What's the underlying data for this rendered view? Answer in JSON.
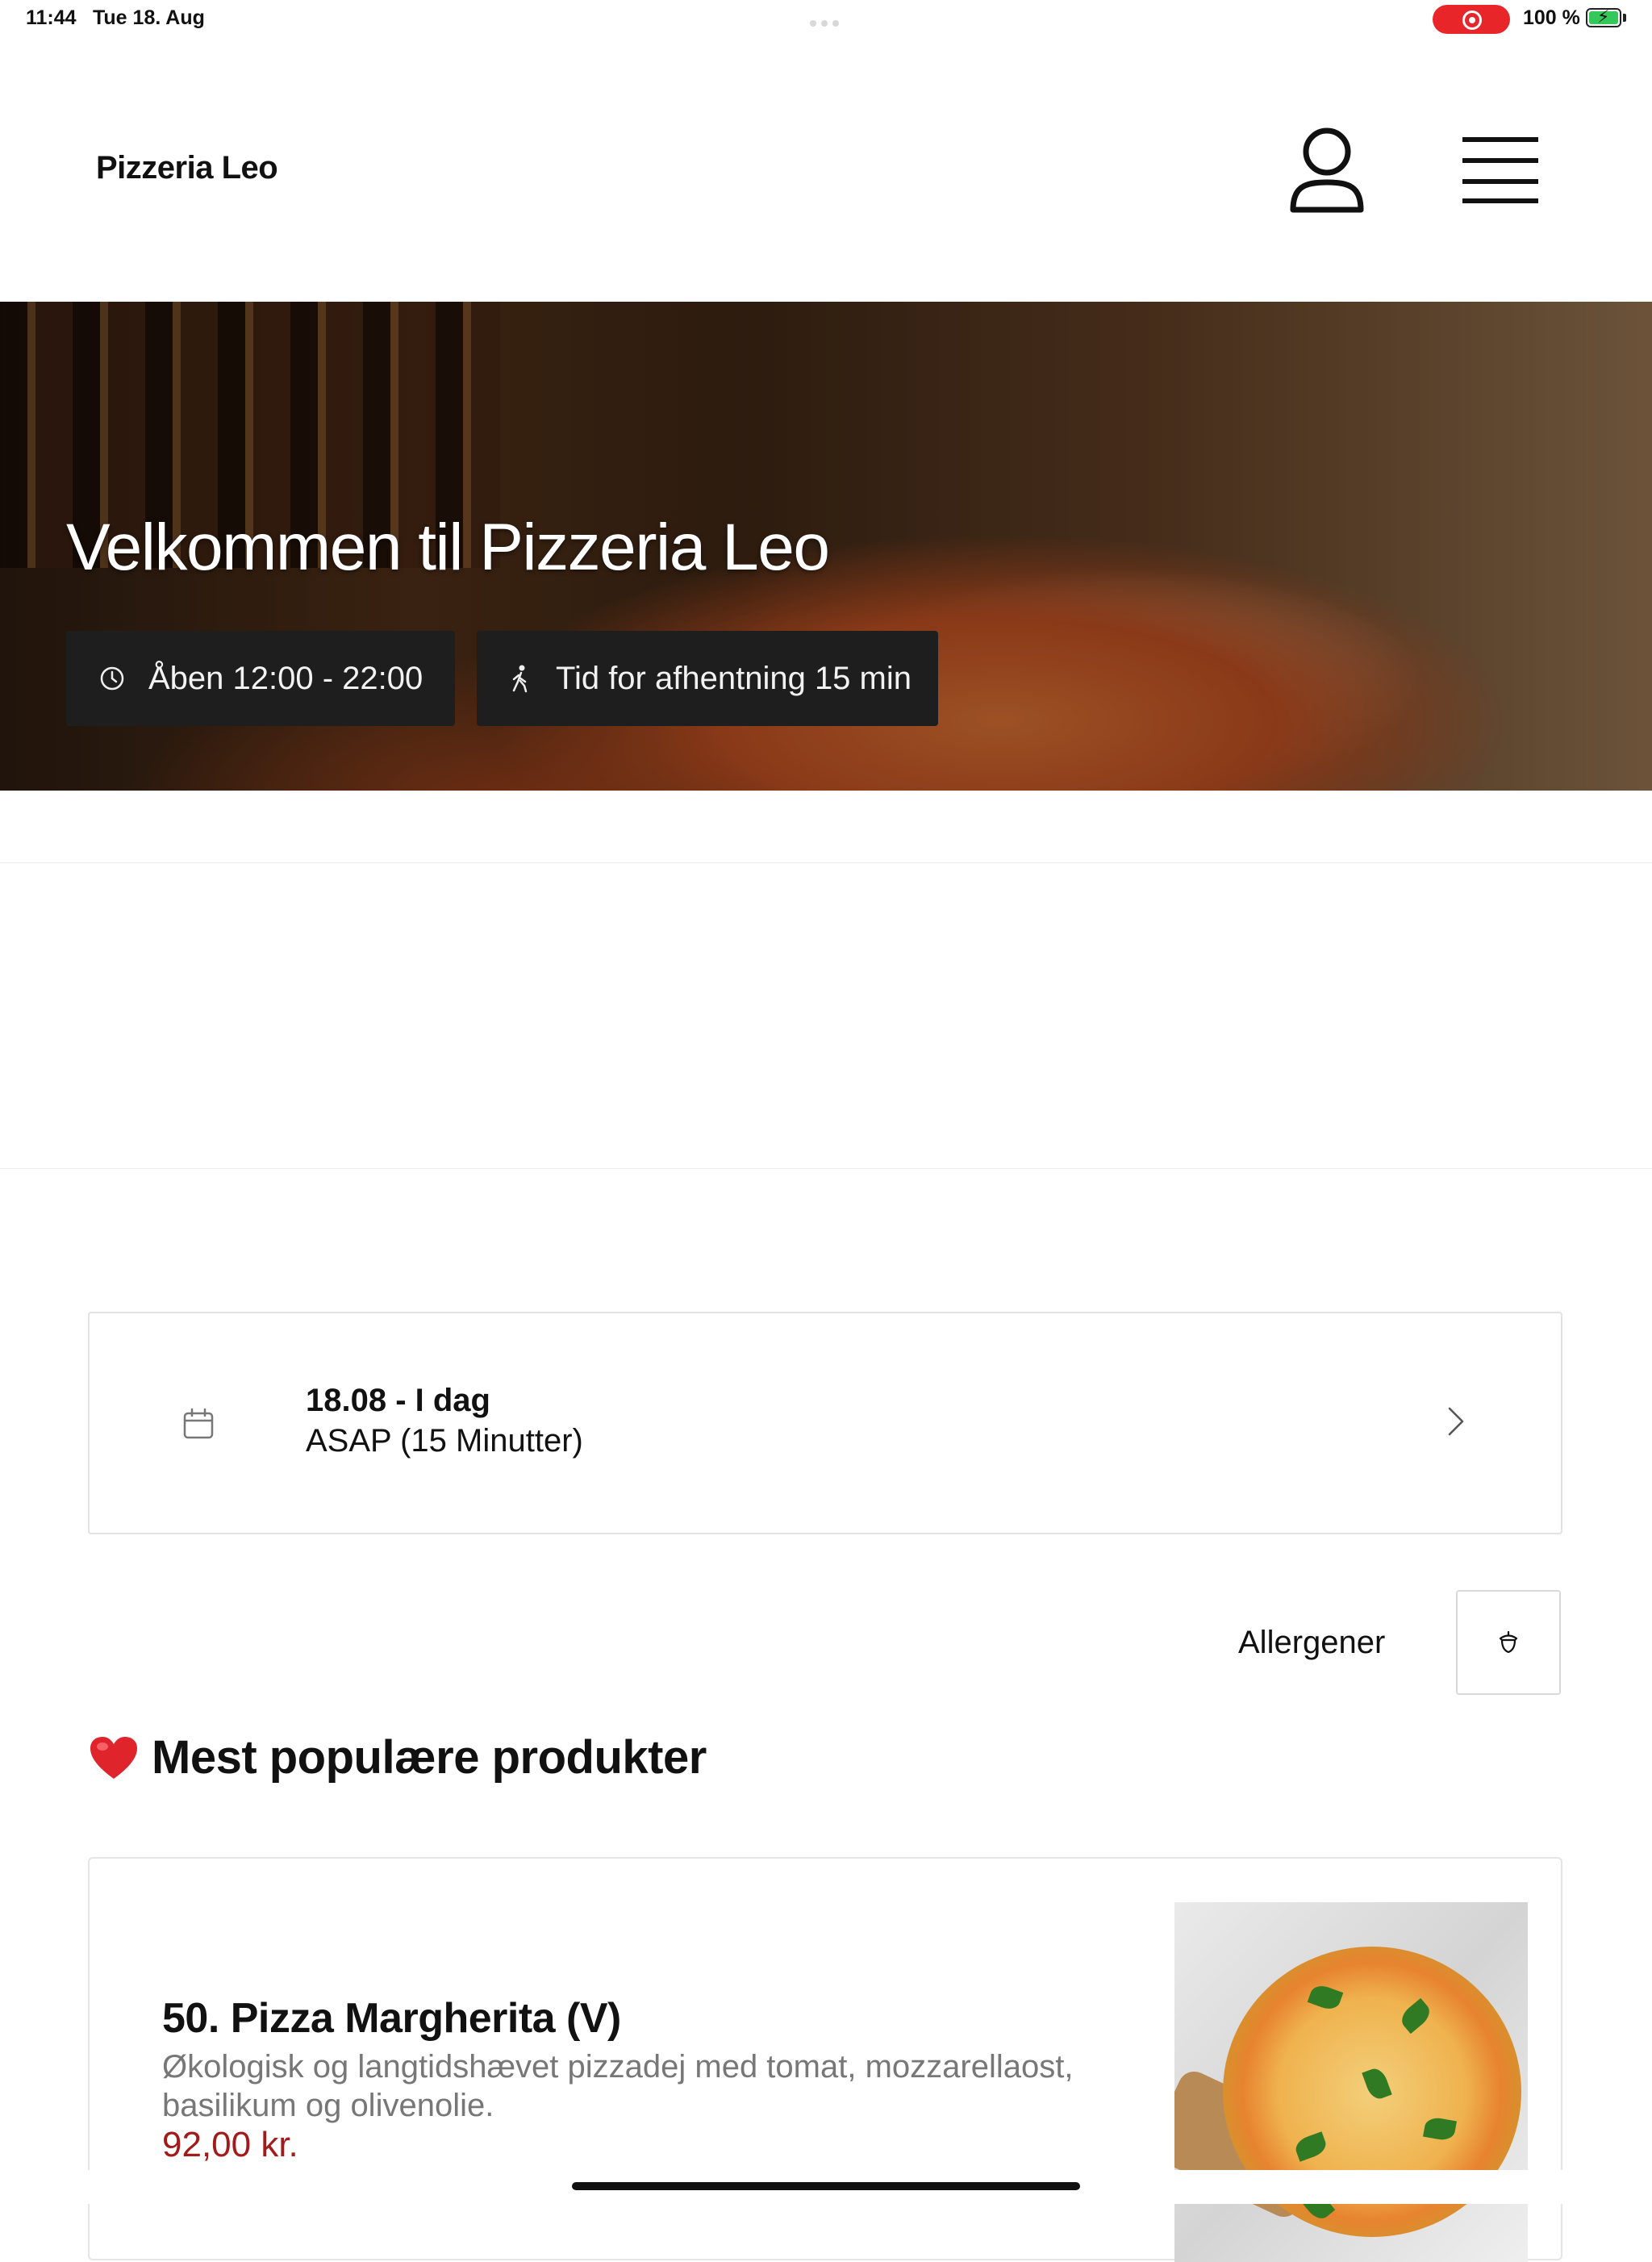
{
  "status_bar": {
    "time": "11:44",
    "date": "Tue 18. Aug",
    "battery": "100 %",
    "record_color": "#e8262a",
    "battery_color": "#34c759"
  },
  "header": {
    "brand": "Pizzeria Leo",
    "user_icon": "user-icon",
    "menu_icon": "hamburger-menu-icon"
  },
  "hero": {
    "title": "Velkommen til Pizzeria Leo",
    "open_hours": "Åben 12:00 - 22:00",
    "pickup_time": "Tid for afhentning 15 min",
    "open_icon": "clock-icon",
    "pickup_icon": "walking-person-icon"
  },
  "date_selector": {
    "date": "18.08 - I dag",
    "time": "ASAP (15 Minutter)",
    "icon": "calendar-icon",
    "chevron": "chevron-right-icon"
  },
  "allergens": {
    "label": "Allergener",
    "icon": "acorn-icon"
  },
  "section": {
    "title": "Mest populære produkter",
    "icon": "heart-icon"
  },
  "products": [
    {
      "name": "50. Pizza Margherita (V)",
      "description": "Økologisk og langtidshævet pizzadej med tomat, mozzarellaost, basilikum og olivenolie.",
      "price": "92,00 kr.",
      "price_color": "#a31a1a"
    }
  ]
}
